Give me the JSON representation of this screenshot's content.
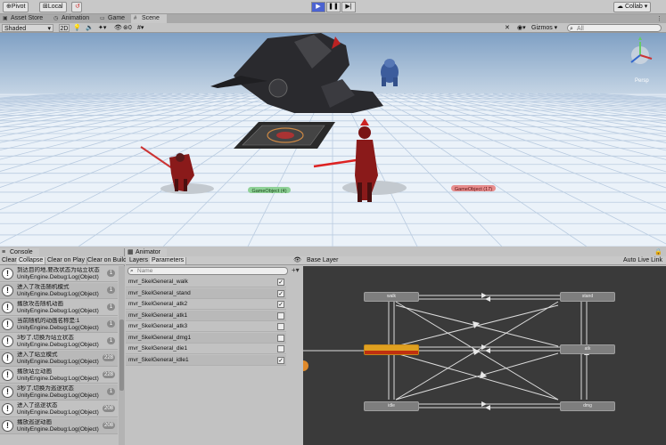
{
  "toolbar": {
    "pivot_label": "Pivot",
    "local_label": "Local",
    "collab_label": "Collab",
    "play_icon": "play-icon",
    "pause_icon": "pause-icon",
    "step_icon": "step-icon",
    "play_active_color": "#4c63d1"
  },
  "tabs": [
    {
      "label": "Asset Store",
      "icon": "asset-store-icon"
    },
    {
      "label": "Animation",
      "icon": "animation-icon"
    },
    {
      "label": "Game",
      "icon": "game-icon"
    },
    {
      "label": "Scene",
      "icon": "scene-icon"
    }
  ],
  "scene_toolbar": {
    "shading_mode": "Shaded",
    "mode_2d": "2D",
    "audio_count": "0",
    "gizmos_label": "Gizmos",
    "search_placeholder": "All"
  },
  "scene": {
    "label_green": "GameObject (4)",
    "label_red": "GameObject (17)",
    "persp_label": "Persp",
    "sky_color": "#9fb5cc",
    "ground_color": "#ebf2f9",
    "grid_color": "#b9cbe0"
  },
  "console": {
    "tab_label": "Console",
    "buttons": [
      "Clear",
      "Collapse",
      "Clear on Play",
      "Clear on Build"
    ],
    "logs": [
      {
        "line1": "到达目的地,要改状态为站立状态",
        "line2": "UnityEngine.Debug:Log(Object)",
        "count": "1"
      },
      {
        "line1": "进入了攻击随机模式",
        "line2": "UnityEngine.Debug:Log(Object)",
        "count": "1"
      },
      {
        "line1": "播放攻击随机动画",
        "line2": "UnityEngine.Debug:Log(Object)",
        "count": "1"
      },
      {
        "line1": "当前随机的动画名称是:1",
        "line2": "UnityEngine.Debug:Log(Object)",
        "count": "1"
      },
      {
        "line1": "3秒了,切换为站立状态",
        "line2": "UnityEngine.Debug:Log(Object)",
        "count": "1"
      },
      {
        "line1": "进入了站立模式",
        "line2": "UnityEngine.Debug:Log(Object)",
        "count": "228"
      },
      {
        "line1": "播放站立动画",
        "line2": "UnityEngine.Debug:Log(Object)",
        "count": "228"
      },
      {
        "line1": "3秒了,切换为巡逻状态",
        "line2": "UnityEngine.Debug:Log(Object)",
        "count": "1"
      },
      {
        "line1": "进入了巡逻状态",
        "line2": "UnityEngine.Debug:Log(Object)",
        "count": "208"
      },
      {
        "line1": "播放巡逻动画",
        "line2": "UnityEngine.Debug:Log(Object)",
        "count": "208"
      }
    ]
  },
  "animator": {
    "tab_label": "Animator",
    "sub_tabs": [
      "Layers",
      "Parameters"
    ],
    "search_placeholder": "Name",
    "add_label": "+",
    "base_layer": "Base Layer",
    "auto_live_link": "Auto Live Link",
    "parameters": [
      {
        "name": "mvr_SkelGeneral_walk",
        "checked": true
      },
      {
        "name": "mvr_SkelGeneral_stand",
        "checked": true
      },
      {
        "name": "mvr_SkelGeneral_atk2",
        "checked": true
      },
      {
        "name": "mvr_SkelGeneral_atk1",
        "checked": false
      },
      {
        "name": "mvr_SkelGeneral_atk3",
        "checked": false
      },
      {
        "name": "mvr_SkelGeneral_dmg1",
        "checked": false
      },
      {
        "name": "mvr_SkelGeneral_die1",
        "checked": false
      },
      {
        "name": "mvr_SkelGeneral_idle1",
        "checked": true
      }
    ],
    "check_mark": "✓",
    "active_state_color": "#e0a020"
  }
}
